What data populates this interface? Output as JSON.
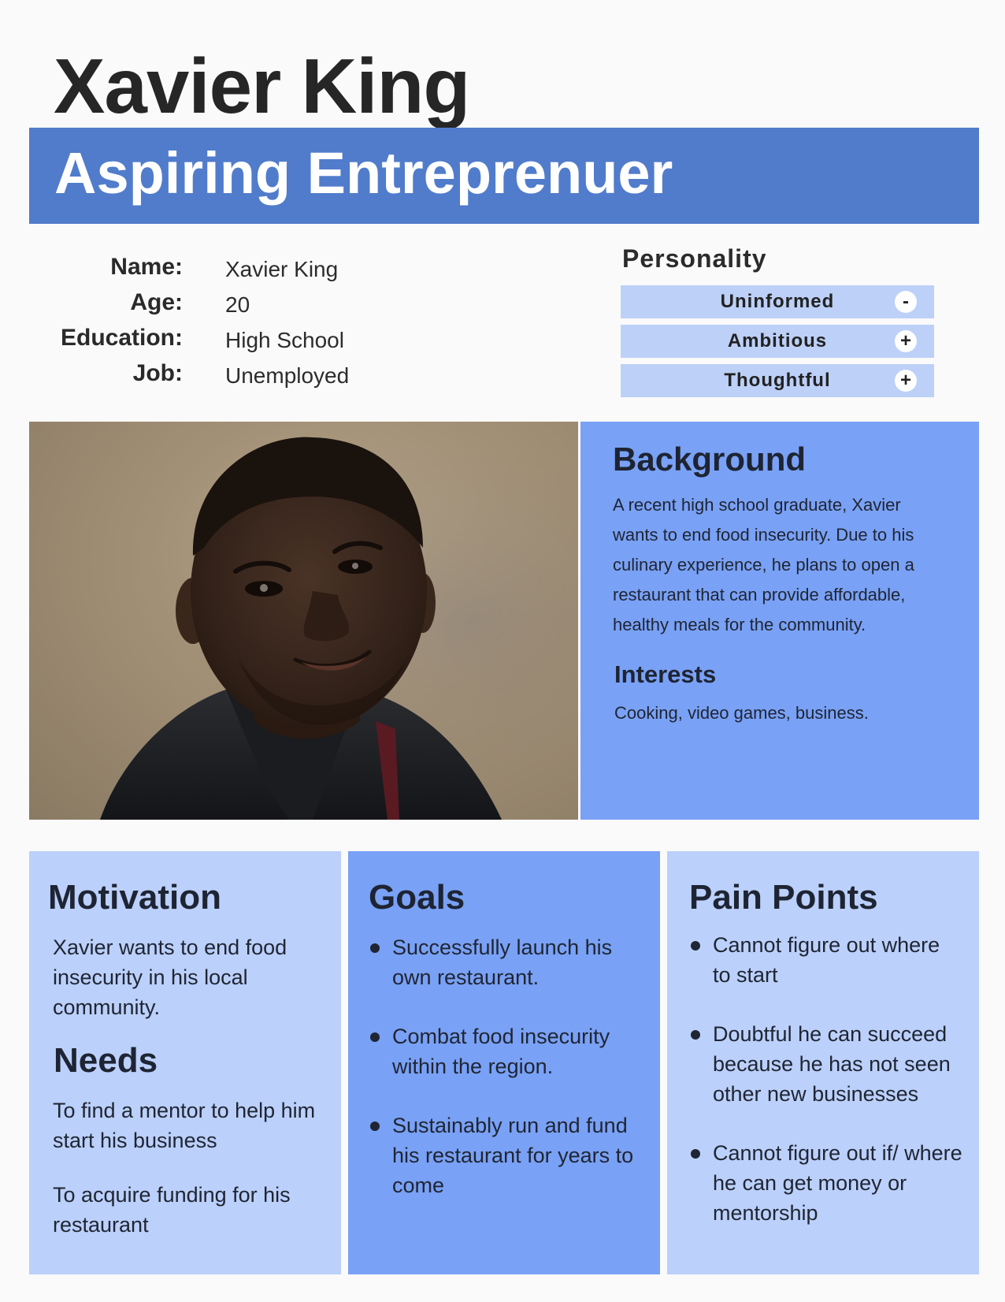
{
  "persona": {
    "name": "Xavier King",
    "role": "Aspiring Entreprenuer"
  },
  "info": {
    "rows": [
      {
        "label": "Name:",
        "value": "Xavier King"
      },
      {
        "label": "Age:",
        "value": "20"
      },
      {
        "label": "Education:",
        "value": "High School"
      },
      {
        "label": "Job:",
        "value": "Unemployed"
      }
    ]
  },
  "personality": {
    "title": "Personality",
    "traits": [
      {
        "label": "Uninformed",
        "sign": "-"
      },
      {
        "label": "Ambitious",
        "sign": "+"
      },
      {
        "label": "Thoughtful",
        "sign": "+"
      }
    ]
  },
  "background": {
    "title": "Background",
    "text": "A recent high school graduate, Xavier wants to end food insecurity. Due to his culinary experience, he plans to open a restaurant that can provide affordable, healthy meals for the community.",
    "interests_title": "Interests",
    "interests_text": "Cooking, video games, business."
  },
  "motivation": {
    "title": "Motivation",
    "text": "Xavier wants to end food insecurity in his local community."
  },
  "needs": {
    "title": "Needs",
    "items": [
      "To find a mentor to help him start his business",
      "To acquire funding for his restaurant"
    ]
  },
  "goals": {
    "title": "Goals",
    "items": [
      "Successfully launch his own restaurant.",
      "Combat food insecurity within the region.",
      "Sustainably run and fund his restaurant for years to come"
    ]
  },
  "pain_points": {
    "title": "Pain Points",
    "items": [
      "Cannot figure out where to start",
      "Doubtful he can succeed because he has not seen other new businesses",
      "Cannot figure out if/ where he can get money or mentorship"
    ]
  },
  "colors": {
    "banner": "#517ccb",
    "panel_mid": "#79a1f5",
    "panel_light": "#bbd0fa",
    "trait_bar": "#bcd0f8"
  }
}
